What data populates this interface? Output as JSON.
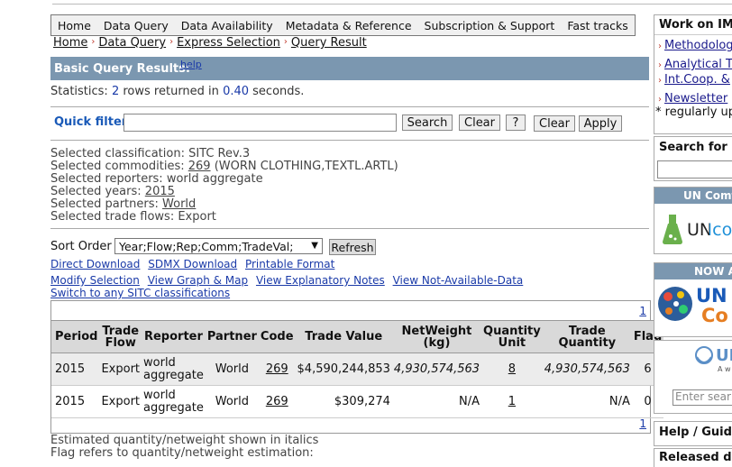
{
  "nav": {
    "items": [
      "Home",
      "Data Query",
      "Data Availability",
      "Metadata & Reference",
      "Subscription & Support",
      "Fast tracks"
    ]
  },
  "breadcrumb": [
    "Home",
    "Data Query",
    "Express Selection",
    "Query Result"
  ],
  "banner": {
    "title": "Basic Query Results:",
    "help": "help"
  },
  "stats": {
    "prefix": "Statistics:",
    "rows": "2",
    "middle": "rows returned in",
    "seconds": "0.40",
    "suffix": "seconds."
  },
  "quick_filter": {
    "label": "Quick filter",
    "value": "",
    "search": "Search",
    "clear": "Clear",
    "question": "?",
    "clear2": "Clear",
    "apply": "Apply"
  },
  "selection": {
    "classification": "Selected classification: SITC Rev.3",
    "commodities_prefix": "Selected commodities:",
    "commodities_code": "269",
    "commodities_desc": "(WORN CLOTHING,TEXTL.ARTL)",
    "reporters": "Selected reporters: world aggregate",
    "years_prefix": "Selected years:",
    "years_value": "2015",
    "partners_prefix": "Selected partners:",
    "partners_value": "World",
    "flows": "Selected trade flows: Export"
  },
  "sort": {
    "label": "Sort Order",
    "value": "Year;Flow;Rep;Comm;TradeVal;",
    "refresh": "Refresh"
  },
  "links": {
    "row1": [
      "Direct Download",
      "SDMX Download",
      "Printable Format"
    ],
    "row2": [
      "Modify Selection",
      "View Graph & Map",
      "View Explanatory Notes",
      "View Not-Available-Data"
    ],
    "row3": [
      "Switch to any SITC classifications"
    ]
  },
  "table": {
    "page_top": "1",
    "page_bottom": "1",
    "headers": [
      "Period",
      "Trade Flow",
      "Reporter",
      "Partner",
      "Code",
      "Trade Value",
      "NetWeight (kg)",
      "Quantity Unit",
      "Trade Quantity",
      "Flag"
    ],
    "rows": [
      {
        "period": "2015",
        "flow": "Export",
        "reporter": "world aggregate",
        "partner": "World",
        "code": "269",
        "value": "$4,590,244,853",
        "netweight": "4,930,574,563",
        "unit": "8",
        "quantity": "4,930,574,563",
        "flag": "6"
      },
      {
        "period": "2015",
        "flow": "Export",
        "reporter": "world aggregate",
        "partner": "World",
        "code": "269",
        "value": "$309,274",
        "netweight": "N/A",
        "unit": "1",
        "quantity": "N/A",
        "flag": "0"
      }
    ]
  },
  "notes": [
    "Estimated quantity/netweight shown in italics",
    "Flag refers to quantity/netweight estimation:"
  ],
  "sidebar": {
    "work_title": "Work on IMT",
    "work_items": [
      "Methodology",
      "Analytical T",
      "Int.Coop. &",
      "Newsletter"
    ],
    "work_note": "* regularly up",
    "search_title": "Search for h",
    "uncomtrade_head": "UN Comt",
    "uncomtrade_logo": "UNco",
    "now_head": "NOW AV",
    "un_logo_top": "UN",
    "un_logo_bottom": "Co",
    "un_small": "UN",
    "un_small_sub": "A w",
    "enter_search": "Enter sear",
    "help_title": "Help / Guide",
    "released_title": "Released d"
  },
  "colors": {
    "banner": "#7b97b0",
    "link": "#1a1a8c",
    "header_bg": "#d9d9d9"
  }
}
